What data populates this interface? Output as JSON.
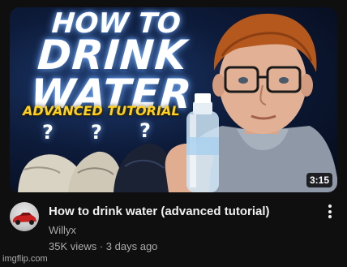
{
  "thumbnail": {
    "headline_line1": "HOW TO",
    "headline_line2": "DRINK",
    "headline_line3": "WATER",
    "subheadline": "ADVANCED TUTORIAL",
    "question_mark": "?",
    "duration": "3:15",
    "colors": {
      "headline": "#ffffff",
      "subheadline": "#ffd21e",
      "background": "#0d1b3a"
    }
  },
  "video": {
    "title": "How to drink water (advanced tutorial)",
    "channel": "Willyx",
    "meta": "35K views · 3 days ago"
  },
  "icons": {
    "menu": "more-vert-icon",
    "avatar": "channel-avatar-car"
  },
  "watermark": "imgflip.com"
}
